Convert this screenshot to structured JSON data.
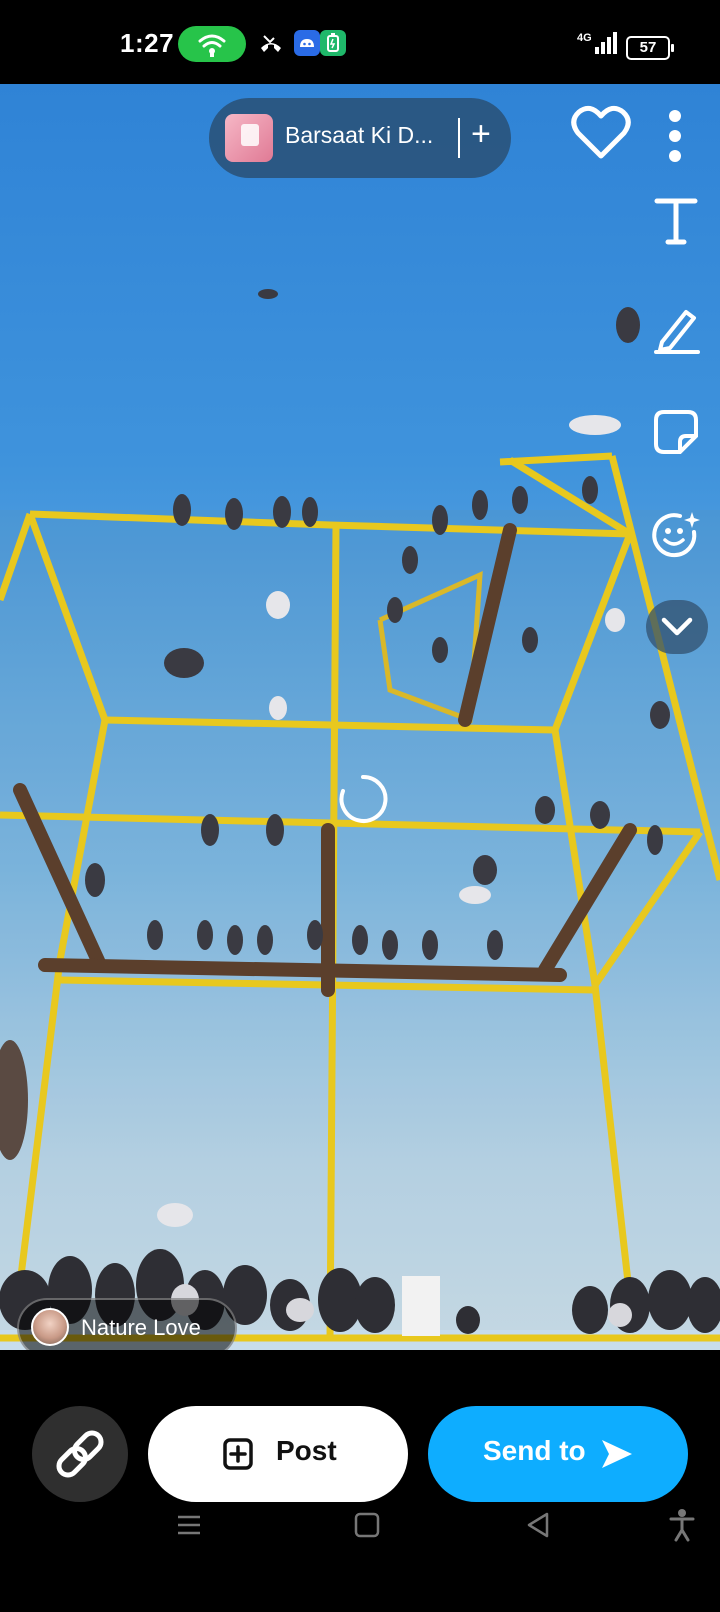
{
  "status_bar": {
    "time": "1:27",
    "network_label": "4G",
    "battery_level": "57",
    "icons": [
      "hotspot-icon",
      "missed-call-icon",
      "android-app-icon",
      "battery-saver-icon",
      "signal-icon",
      "battery-icon"
    ],
    "colors": {
      "hotspot": "#27c44a",
      "android_app": "#2a6be6",
      "battery_saver": "#1fb86a"
    }
  },
  "music": {
    "title": "Barsaat Ki D...",
    "add_label": "+"
  },
  "top_actions": {
    "icons": [
      "heart-icon",
      "more-vertical-icon"
    ]
  },
  "edit_tools": {
    "icons": [
      "text-tool-icon",
      "draw-pencil-icon",
      "sticker-icon",
      "lens-smile-sparkle-icon",
      "chevron-down-icon"
    ]
  },
  "profile": {
    "name": "Nature Love"
  },
  "actions": {
    "link_icon": "link-icon",
    "post_label": "Post",
    "post_icon": "add-square-icon",
    "send_label": "Send to",
    "send_icon": "send-arrow-icon",
    "send_color": "#0eadff"
  },
  "nav_bar": {
    "icons": [
      "menu-icon",
      "home-square-icon",
      "back-triangle-icon",
      "accessibility-icon"
    ]
  }
}
